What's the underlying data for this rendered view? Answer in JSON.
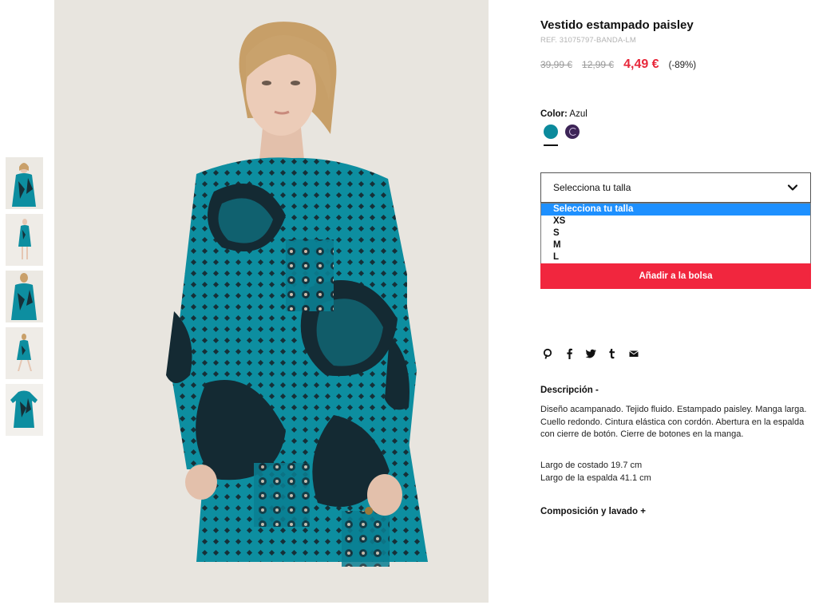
{
  "gallery": {
    "thumbnail_count": 5,
    "colors": {
      "dress": "#0d8ea0",
      "pattern_dark": "#142a33",
      "skin": "#e8c8b4",
      "hair": "#c8a06a",
      "background": "#e8e5df"
    }
  },
  "product": {
    "title": "Vestido estampado paisley",
    "ref": "REF. 31075797-BANDA-LM",
    "price_original": "39,99 €",
    "price_previous": "12,99 €",
    "price_current": "4,49 €",
    "discount": "(-89%)"
  },
  "color": {
    "label": "Color:",
    "value": "Azul",
    "swatches": [
      {
        "name": "teal",
        "hex": "#0b8a9c",
        "selected": true
      },
      {
        "name": "purple",
        "hex": "#3d2457",
        "selected": false
      }
    ]
  },
  "size": {
    "placeholder": "Selecciona tu talla",
    "options": [
      "Selecciona tu talla",
      "XS",
      "S",
      "M",
      "L"
    ],
    "highlighted_index": 0
  },
  "cart": {
    "add_label": "Añadir a la bolsa"
  },
  "share": {
    "icons": [
      "pinterest-icon",
      "facebook-icon",
      "twitter-icon",
      "tumblr-icon",
      "email-icon"
    ]
  },
  "description": {
    "title": "Descripción -",
    "text": "Diseño acampanado. Tejido fluido. Estampado paisley. Manga larga. Cuello redondo. Cintura elástica con cordón. Abertura en la espalda con cierre de botón. Cierre de botones en la manga.",
    "length_side": "Largo de costado 19.7 cm",
    "length_back": "Largo de la espalda 41.1 cm"
  },
  "composition": {
    "title": "Composición y lavado +"
  },
  "theme": {
    "accent": "#f1263e",
    "price_red": "#e8283b",
    "select_highlight": "#1e90ff"
  }
}
